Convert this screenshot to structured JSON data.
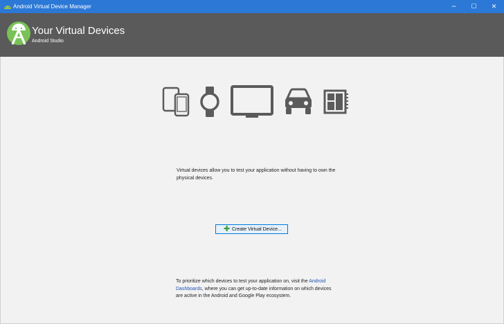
{
  "window": {
    "title": "Android Virtual Device Manager",
    "controls": {
      "minimize": "–",
      "maximize": "☐",
      "close": "✕"
    }
  },
  "header": {
    "title": "Your Virtual Devices",
    "subtitle": "Android Studio",
    "logo_icon": "android-studio-logo-icon"
  },
  "device_icons": [
    "phone-tablet-icon",
    "watch-icon",
    "tv-icon",
    "car-icon",
    "things-board-icon"
  ],
  "intro_text": "Virtual devices allow you to test your application without having to own the physical devices.",
  "create_button": {
    "icon": "✚",
    "label": "Create Virtual Device..."
  },
  "footer": {
    "text_before": "To prioritize which devices to test your application on, visit the ",
    "link_text": "Android Dashboards",
    "text_after": ", where you can get up-to-date information on which devices are active in the Android and Google Play ecosystem."
  },
  "colors": {
    "titlebar": "#2b78d6",
    "header": "#5a5a5a",
    "icon_gray": "#5b5b5b",
    "link": "#2152b4",
    "android_green": "#78c257"
  }
}
